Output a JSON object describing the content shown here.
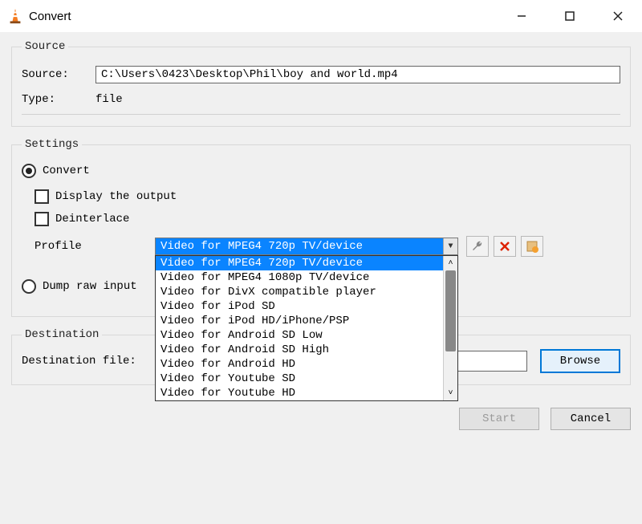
{
  "window": {
    "title": "Convert"
  },
  "source": {
    "legend": "Source",
    "source_label": "Source:",
    "source_value": "C:\\Users\\0423\\Desktop\\Phil\\boy and world.mp4",
    "type_label": "Type:",
    "type_value": "file"
  },
  "settings": {
    "legend": "Settings",
    "convert_label": "Convert",
    "display_output_label": "Display the output",
    "deinterlace_label": "Deinterlace",
    "profile_label": "Profile",
    "profile_selected": "Video for MPEG4 720p TV/device",
    "profile_options": [
      "Video for MPEG4 720p TV/device",
      "Video for MPEG4 1080p TV/device",
      "Video for DivX compatible player",
      "Video for iPod SD",
      "Video for iPod HD/iPhone/PSP",
      "Video for Android SD Low",
      "Video for Android SD High",
      "Video for Android HD",
      "Video for Youtube SD",
      "Video for Youtube HD"
    ],
    "dump_raw_label": "Dump raw input"
  },
  "destination": {
    "legend": "Destination",
    "dest_file_label": "Destination file:",
    "dest_file_value": "",
    "browse_label": "Browse"
  },
  "footer": {
    "start_label": "Start",
    "cancel_label": "Cancel"
  }
}
